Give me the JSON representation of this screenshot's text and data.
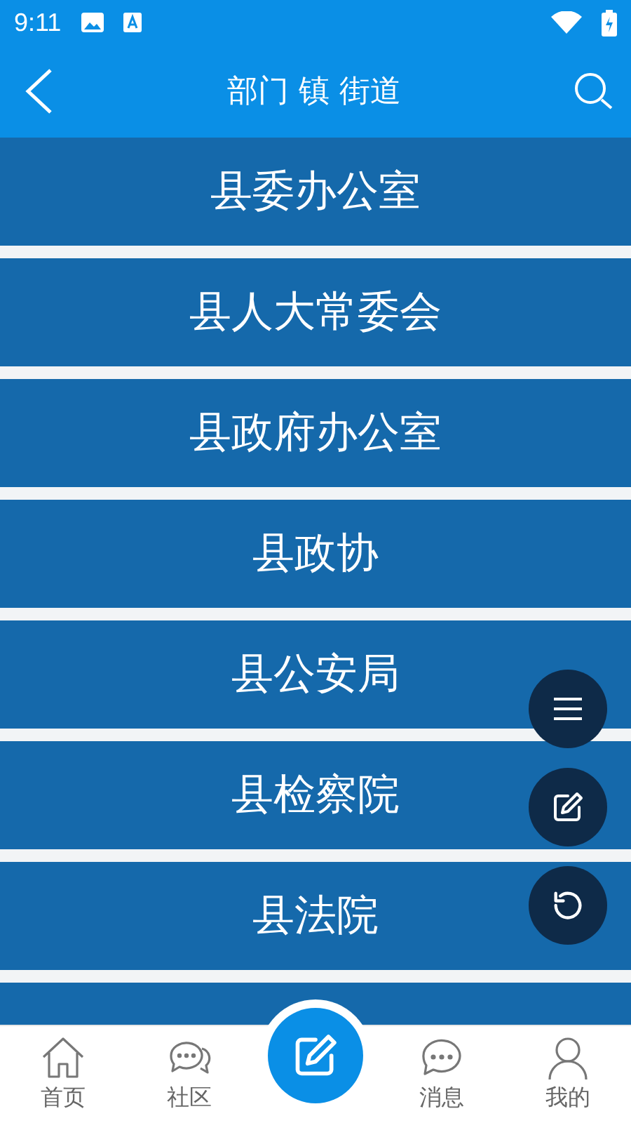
{
  "status_bar": {
    "time": "9:11"
  },
  "header": {
    "title": "部门 镇 街道"
  },
  "departments": [
    {
      "name": "县委办公室"
    },
    {
      "name": "县人大常委会"
    },
    {
      "name": "县政府办公室"
    },
    {
      "name": "县政协"
    },
    {
      "name": "县公安局"
    },
    {
      "name": "县检察院"
    },
    {
      "name": "县法院"
    }
  ],
  "floating_actions": [
    {
      "kind": "menu"
    },
    {
      "kind": "edit"
    },
    {
      "kind": "refresh"
    }
  ],
  "bottom_nav": [
    {
      "kind": "home",
      "label": "首页"
    },
    {
      "kind": "community",
      "label": "社区"
    },
    {
      "kind": "compose"
    },
    {
      "kind": "messages",
      "label": "消息"
    },
    {
      "kind": "profile",
      "label": "我的"
    }
  ]
}
